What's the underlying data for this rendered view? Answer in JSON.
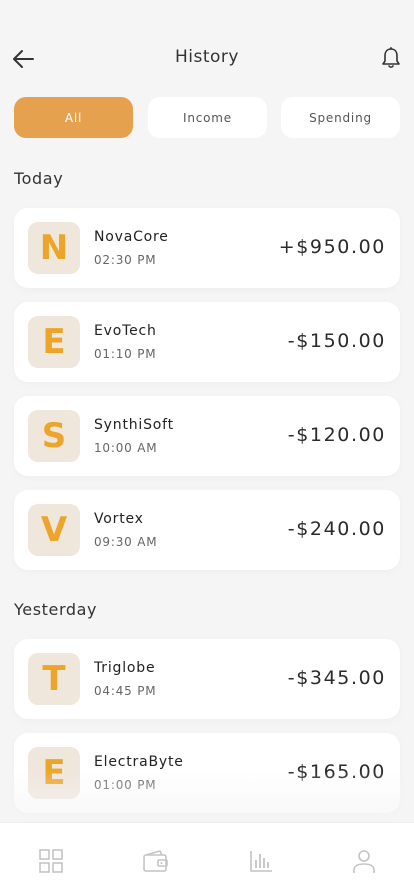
{
  "header": {
    "title": "History",
    "back_icon": "arrow-left-icon",
    "notification_icon": "bell-icon"
  },
  "filters": {
    "tabs": [
      {
        "label": "All",
        "active": true
      },
      {
        "label": "Income",
        "active": false
      },
      {
        "label": "Spending",
        "active": false
      }
    ]
  },
  "sections": [
    {
      "title": "Today",
      "transactions": [
        {
          "initial": "N",
          "name": "NovaCore",
          "time": "02:30 PM",
          "amount": "+$950.00"
        },
        {
          "initial": "E",
          "name": "EvoTech",
          "time": "01:10 PM",
          "amount": "-$150.00"
        },
        {
          "initial": "S",
          "name": "SynthiSoft",
          "time": "10:00 AM",
          "amount": "-$120.00"
        },
        {
          "initial": "V",
          "name": "Vortex",
          "time": "09:30 AM",
          "amount": "-$240.00"
        }
      ]
    },
    {
      "title": "Yesterday",
      "transactions": [
        {
          "initial": "T",
          "name": "Triglobe",
          "time": "04:45 PM",
          "amount": "-$345.00"
        },
        {
          "initial": "E",
          "name": "ElectraByte",
          "time": "01:00 PM",
          "amount": "-$165.00"
        }
      ]
    }
  ],
  "bottom_nav": {
    "items": [
      {
        "icon": "dashboard-grid-icon"
      },
      {
        "icon": "wallet-icon"
      },
      {
        "icon": "bar-chart-icon"
      },
      {
        "icon": "user-profile-icon"
      }
    ]
  },
  "colors": {
    "accent": "#e6a14f",
    "logo_letter": "#eca52a",
    "logo_background": "#efe6dc",
    "background": "#f5f5f5"
  }
}
